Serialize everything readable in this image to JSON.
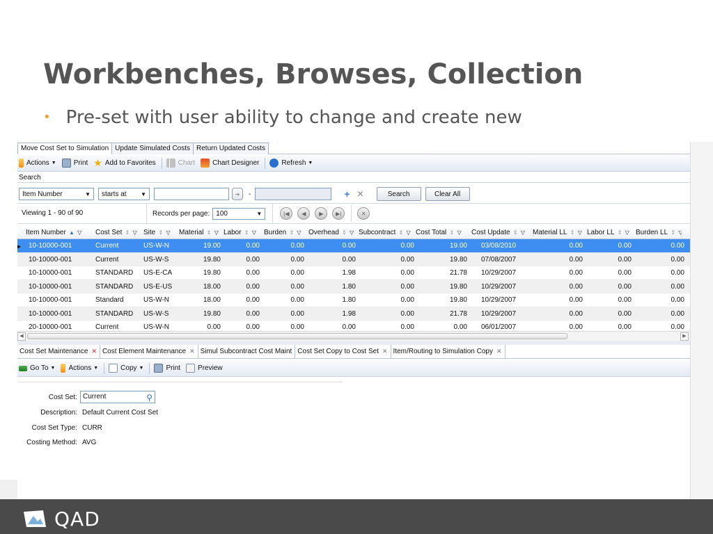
{
  "slide": {
    "title": "Workbenches, Browses, Collection",
    "bullet": "Pre-set with user ability to change and create new"
  },
  "top_tabs": [
    "Move Cost Set to Simulation",
    "Update Simulated Costs",
    "Return Updated Costs"
  ],
  "toolbar1": {
    "actions": "Actions",
    "print": "Print",
    "add_favorites": "Add to Favorites",
    "chart": "Chart",
    "chart_designer": "Chart Designer",
    "refresh": "Refresh"
  },
  "search": {
    "label": "Search",
    "field": "Item Number",
    "operator": "starts at",
    "dash": "-",
    "search_button": "Search",
    "clear_button": "Clear All"
  },
  "paging": {
    "viewing": "Viewing  1 - 90  of  90",
    "records_label": "Records per page:",
    "records_value": "100"
  },
  "grid": {
    "columns": [
      "Item Number",
      "Cost Set",
      "Site",
      "Material",
      "Labor",
      "Burden",
      "Overhead",
      "Subcontract",
      "Cost Total",
      "Cost Update",
      "Material LL",
      "Labor LL",
      "Burden LL"
    ],
    "rows": [
      [
        "10-10000-001",
        "Current",
        "US-W-N",
        "19.00",
        "0.00",
        "0.00",
        "0.00",
        "0.00",
        "19.00",
        "03/08/2010",
        "0.00",
        "0.00",
        "0.00"
      ],
      [
        "10-10000-001",
        "Current",
        "US-W-S",
        "19.80",
        "0.00",
        "0.00",
        "0.00",
        "0.00",
        "19.80",
        "07/08/2007",
        "0.00",
        "0.00",
        "0.00"
      ],
      [
        "10-10000-001",
        "STANDARD",
        "US-E-CA",
        "19.80",
        "0.00",
        "0.00",
        "1.98",
        "0.00",
        "21.78",
        "10/29/2007",
        "0.00",
        "0.00",
        "0.00"
      ],
      [
        "10-10000-001",
        "STANDARD",
        "US-E-US",
        "18.00",
        "0.00",
        "0.00",
        "1.80",
        "0.00",
        "19.80",
        "10/29/2007",
        "0.00",
        "0.00",
        "0.00"
      ],
      [
        "10-10000-001",
        "Standard",
        "US-W-N",
        "18.00",
        "0.00",
        "0.00",
        "1.80",
        "0.00",
        "19.80",
        "10/29/2007",
        "0.00",
        "0.00",
        "0.00"
      ],
      [
        "10-10000-001",
        "STANDARD",
        "US-W-S",
        "19.80",
        "0.00",
        "0.00",
        "1.98",
        "0.00",
        "21.78",
        "10/29/2007",
        "0.00",
        "0.00",
        "0.00"
      ],
      [
        "20-10000-001",
        "Current",
        "US-W-N",
        "0.00",
        "0.00",
        "0.00",
        "0.00",
        "0.00",
        "0.00",
        "06/01/2007",
        "0.00",
        "0.00",
        "0.00"
      ]
    ]
  },
  "bottom_tabs": [
    "Cost Set Maintenance",
    "Cost Element Maintenance",
    "Simul Subcontract Cost Maint",
    "Cost Set Copy to Cost Set",
    "Item/Routing to Simulation Copy"
  ],
  "toolbar2": {
    "goto": "Go To",
    "actions": "Actions",
    "copy": "Copy",
    "print": "Print",
    "preview": "Preview"
  },
  "form": {
    "cost_set_label": "Cost Set:",
    "cost_set_value": "Current",
    "description_label": "Description:",
    "description_value": "Default Current Cost Set",
    "type_label": "Cost Set Type:",
    "type_value": "CURR",
    "method_label": "Costing Method:",
    "method_value": "AVG"
  },
  "footer": {
    "logo_text": "QAD"
  }
}
